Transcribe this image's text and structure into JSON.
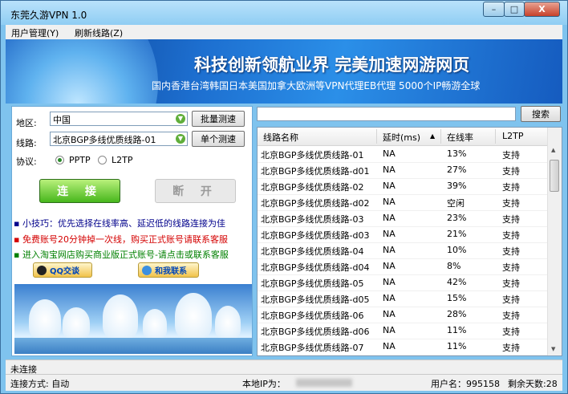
{
  "window": {
    "title": "东莞久游VPN 1.0",
    "min_glyph": "–",
    "max_glyph": "□",
    "close_glyph": "X"
  },
  "menu": {
    "items": [
      "用户管理(Y)",
      "刷新线路(Z)"
    ]
  },
  "banner": {
    "line1": "科技创新领航业界  完美加速网游网页",
    "line2": "国内香港台湾韩国日本美国加拿大欧洲等VPN代理EB代理 5000个IP畅游全球"
  },
  "form": {
    "region_label": "地区:",
    "region_value": "中国",
    "line_label": "线路:",
    "line_value": "北京BGP多线优质线路-01",
    "protocol_label": "协议:",
    "protocols": [
      "PPTP",
      "L2TP"
    ],
    "protocol_selected": "PPTP",
    "batch_test": "批量测速",
    "single_test": "单个测速",
    "connect": "连 接",
    "disconnect": "断 开"
  },
  "tips": [
    {
      "text": "▪ 小技巧：优先选择在线率高、延迟低的线路连接为佳",
      "color": "#00008b"
    },
    {
      "text": "▪ 免费账号20分钟掉一次线，购买正式账号请联系客服",
      "color": "#d40000"
    },
    {
      "text": "▪ 进入淘宝网店购买商业版正式账号-请点击或联系客服",
      "color": "#008000"
    }
  ],
  "buttons": {
    "qq": "QQ交谈",
    "contact": "和我联系"
  },
  "search": {
    "button": "搜索"
  },
  "table": {
    "headers": [
      "线路名称",
      "延时(ms)",
      "在线率",
      "L2TP"
    ],
    "rows": [
      [
        "北京BGP多线优质线路-01",
        "NA",
        "13%",
        "支持"
      ],
      [
        "北京BGP多线优质线路-d01",
        "NA",
        "27%",
        "支持"
      ],
      [
        "北京BGP多线优质线路-02",
        "NA",
        "39%",
        "支持"
      ],
      [
        "北京BGP多线优质线路-d02",
        "NA",
        "空闲",
        "支持"
      ],
      [
        "北京BGP多线优质线路-03",
        "NA",
        "23%",
        "支持"
      ],
      [
        "北京BGP多线优质线路-d03",
        "NA",
        "21%",
        "支持"
      ],
      [
        "北京BGP多线优质线路-04",
        "NA",
        "10%",
        "支持"
      ],
      [
        "北京BGP多线优质线路-d04",
        "NA",
        "8%",
        "支持"
      ],
      [
        "北京BGP多线优质线路-05",
        "NA",
        "42%",
        "支持"
      ],
      [
        "北京BGP多线优质线路-d05",
        "NA",
        "15%",
        "支持"
      ],
      [
        "北京BGP多线优质线路-06",
        "NA",
        "28%",
        "支持"
      ],
      [
        "北京BGP多线优质线路-d06",
        "NA",
        "11%",
        "支持"
      ],
      [
        "北京BGP多线优质线路-07",
        "NA",
        "11%",
        "支持"
      ]
    ]
  },
  "status": {
    "state": "未连接",
    "mode": "连接方式:  自动",
    "local_ip_label": "本地IP为：",
    "username": "用户名：995158",
    "days_left": "剩余天数:28"
  },
  "icons": {
    "combo": "dropdown-arrow-icon",
    "qq": "qq-icon",
    "contact": "contact-icon"
  }
}
